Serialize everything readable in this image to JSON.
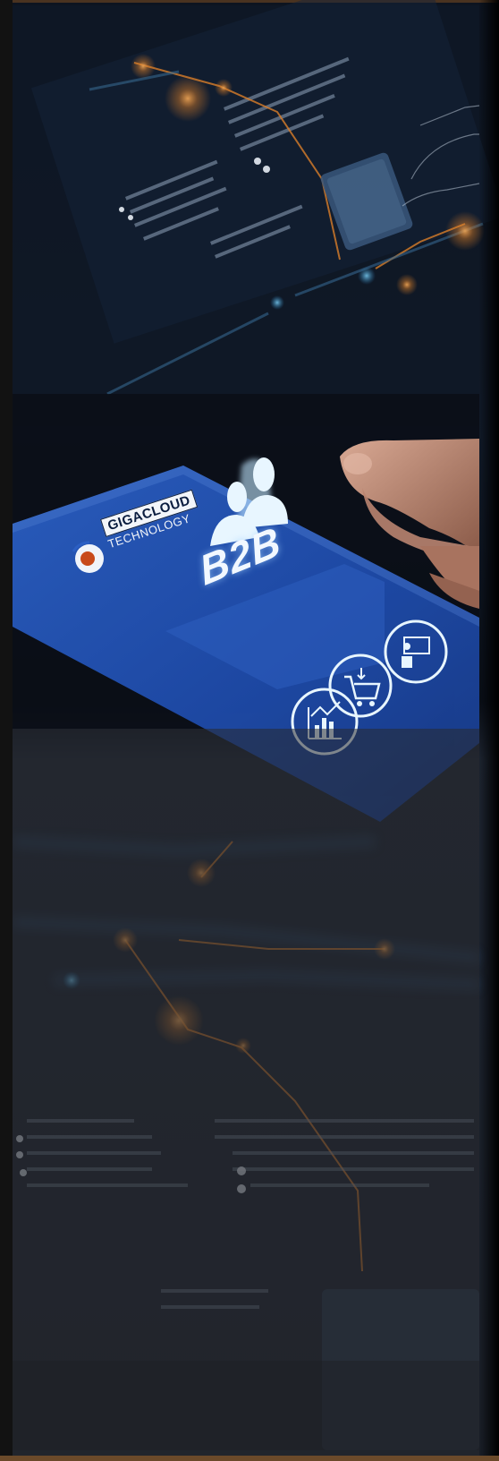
{
  "brand": {
    "name_line1": "GIGACLOUD",
    "name_line2": "TECHNOLOGY"
  },
  "panel": {
    "label": "B2B"
  },
  "icons": [
    "people-icon",
    "user-board-icon",
    "cart-icon",
    "chart-icon"
  ],
  "colors": {
    "panel_blue": "#1e4aa8",
    "glow_orange": "#f08a2a",
    "icon_cyan": "#d6f2ff"
  }
}
